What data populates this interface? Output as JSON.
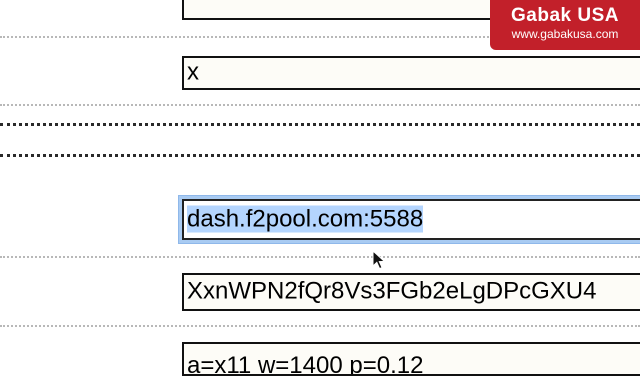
{
  "fields": [
    {
      "name": "top-input",
      "value": ""
    },
    {
      "name": "password-input",
      "value": "x"
    },
    {
      "name": "pool-address-input",
      "value": "dash.f2pool.com:5588"
    },
    {
      "name": "wallet-address-input",
      "value": "XxnWPN2fQr8Vs3FGb2eLgDPcGXU4"
    },
    {
      "name": "extra-params-input",
      "value": "a=x11 w=1400 p=0.12"
    }
  ],
  "watermark": {
    "brand": "Gabak USA",
    "site": "www.gabakusa.com"
  },
  "icons": {
    "cursor": "mouse-pointer-icon"
  },
  "colors": {
    "watermark_bg": "#c2202a",
    "focus_ring": "#a9cbf2",
    "selection": "#b4d5fe"
  }
}
